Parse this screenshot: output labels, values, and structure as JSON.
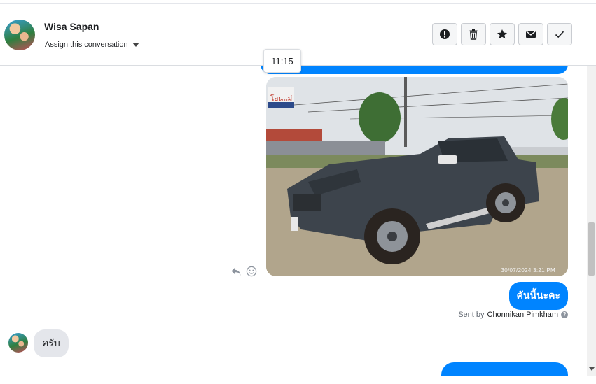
{
  "header": {
    "contact_name": "Wisa Sapan",
    "assign_label": "Assign this conversation",
    "actions": [
      {
        "name": "alert-button",
        "icon": "exclamation-circle-icon"
      },
      {
        "name": "delete-button",
        "icon": "trash-icon"
      },
      {
        "name": "star-button",
        "icon": "star-icon"
      },
      {
        "name": "mark-unread-button",
        "icon": "envelope-icon"
      },
      {
        "name": "mark-done-button",
        "icon": "checkmark-icon"
      }
    ]
  },
  "thread": {
    "tooltip_time": "11:15",
    "photo_stamp": "30/07/2024 3:21 PM",
    "photo_sign_text": "โอนแม่",
    "outgoing_message": "คันนี้นะคะ",
    "sent_by_prefix": "Sent by",
    "sent_by_agent": "Chonnikan Pimkham",
    "incoming_message": "ครับ",
    "colors": {
      "outgoing_bubble": "#0084ff",
      "incoming_bubble": "#e4e6eb"
    }
  }
}
